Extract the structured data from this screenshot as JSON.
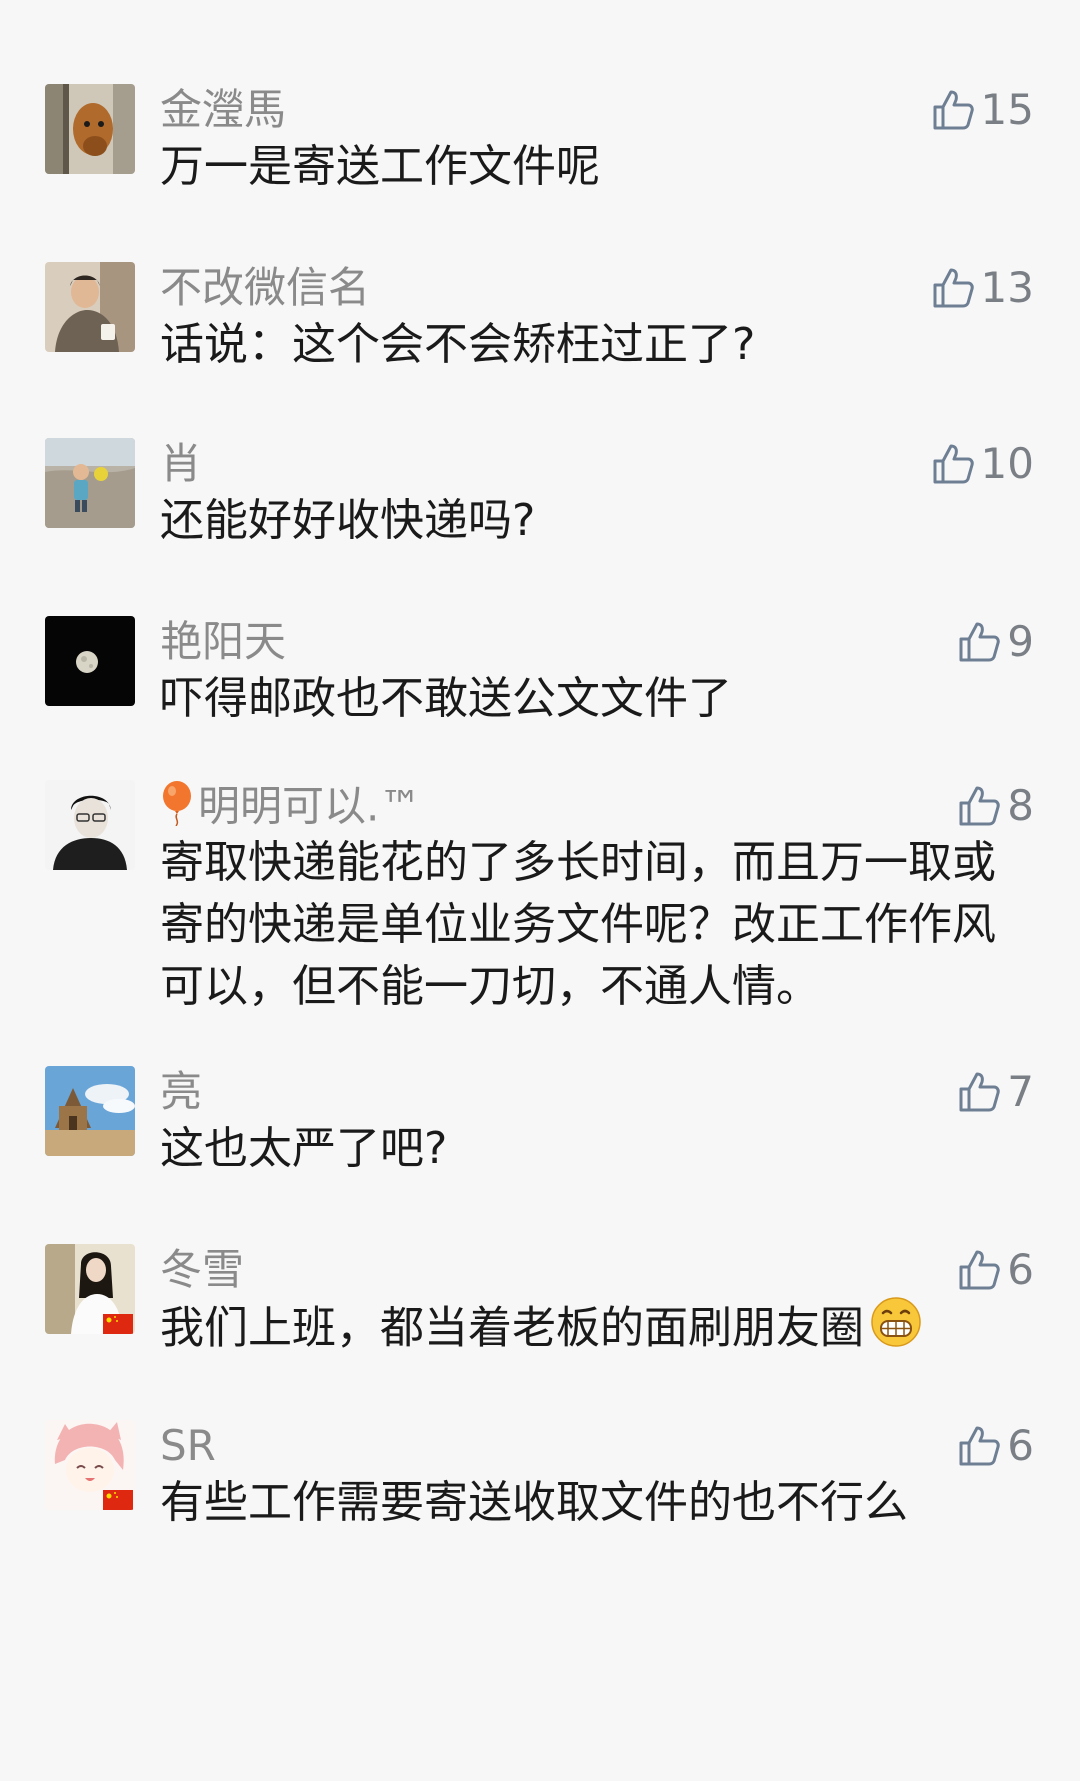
{
  "comments": [
    {
      "username": "金瀅馬",
      "text": "万一是寄送工作文件呢",
      "likes": "15",
      "avatar": "dog-avatar",
      "flag": false
    },
    {
      "username": "不改微信名",
      "text": "话说：这个会不会矫枉过正了?",
      "likes": "13",
      "avatar": "person-avatar",
      "flag": false
    },
    {
      "username": "肖",
      "text": "还能好好收快递吗?",
      "likes": "10",
      "avatar": "child-avatar",
      "flag": false
    },
    {
      "username": "艳阳天",
      "text": "吓得邮政也不敢送公文文件了",
      "likes": "9",
      "avatar": "moon-avatar",
      "flag": false
    },
    {
      "username": "明明可以.™",
      "username_prefix_icon": "balloon-icon",
      "text": "寄取快递能花的了多长时间，而且万一取或寄的快递是单位业务文件呢？改正工作作风可以，但不能一刀切，不通人情。",
      "likes": "8",
      "avatar": "young-man-avatar",
      "flag": false
    },
    {
      "username": "亮",
      "text": "这也太严了吧?",
      "likes": "7",
      "avatar": "beach-avatar",
      "flag": false
    },
    {
      "username": "冬雪",
      "text": "我们上班，都当着老板的面刷朋友圈",
      "text_suffix_icon": "grin-emoji-icon",
      "likes": "6",
      "avatar": "woman-avatar",
      "flag": true
    },
    {
      "username": "SR",
      "text": "有些工作需要寄送收取文件的也不行么",
      "likes": "6",
      "avatar": "anime-girl-avatar",
      "flag": true
    }
  ],
  "colors": {
    "background": "#f7f7f7",
    "username": "#8a8a8a",
    "text": "#1a1a1a",
    "like_icon": "#6e7f94"
  }
}
